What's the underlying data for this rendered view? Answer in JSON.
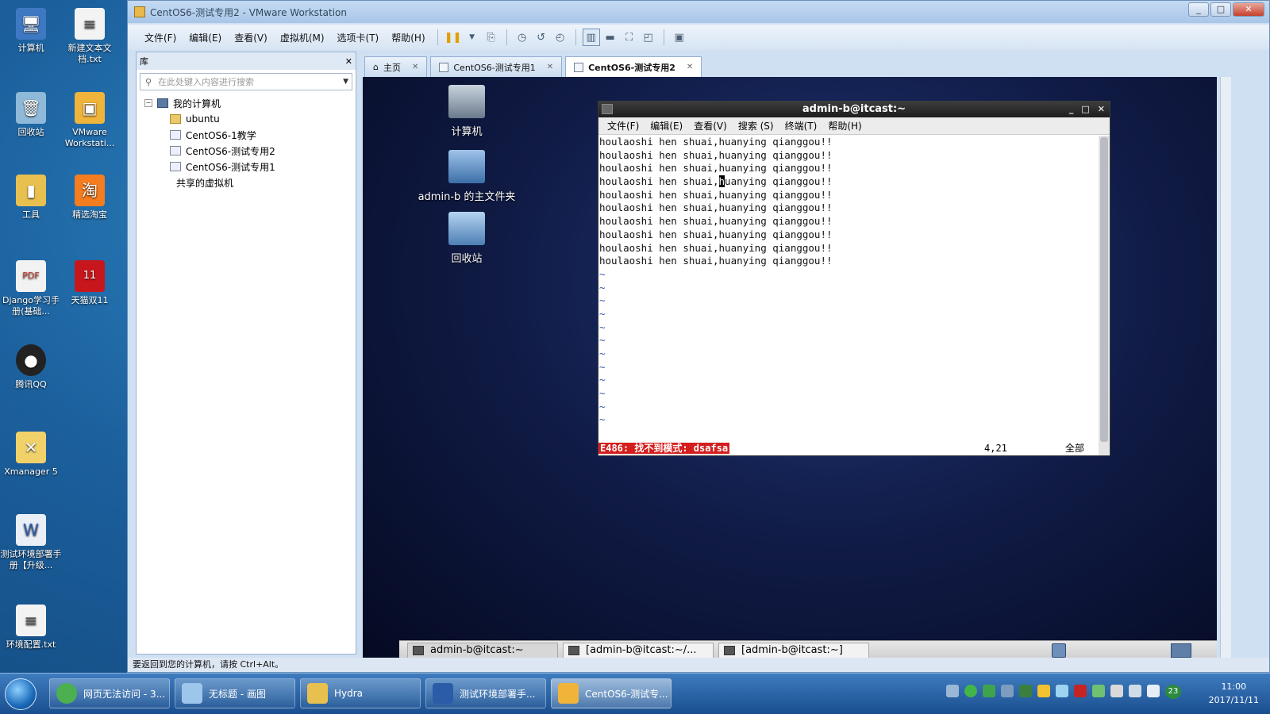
{
  "desktop": {
    "icons": [
      {
        "label": "计算机"
      },
      {
        "label": "新建文本文档.txt"
      },
      {
        "label": "回收站"
      },
      {
        "label": "VMware Workstati..."
      },
      {
        "label": "工具"
      },
      {
        "label": "精选淘宝"
      },
      {
        "label": "Django学习手册(基础..."
      },
      {
        "label": "天猫双11"
      },
      {
        "label": "腾讯QQ"
      },
      {
        "label": "Xmanager 5"
      },
      {
        "label": "测试环境部署手册【升级..."
      },
      {
        "label": "环境配置.txt"
      }
    ]
  },
  "vmware": {
    "title": "CentOS6-测试专用2 - VMware Workstation",
    "menu": [
      "文件(F)",
      "编辑(E)",
      "查看(V)",
      "虚拟机(M)",
      "选项卡(T)",
      "帮助(H)"
    ],
    "library": {
      "title": "库",
      "search_placeholder": "在此处键入内容进行搜索",
      "tree": {
        "root": "我的计算机",
        "items": [
          "ubuntu",
          "CentOS6-1教学",
          "CentOS6-测试专用2",
          "CentOS6-测试专用1"
        ],
        "shared": "共享的虚拟机"
      }
    },
    "tabs": [
      {
        "label": "主页"
      },
      {
        "label": "CentOS6-测试专用1"
      },
      {
        "label": "CentOS6-测试专用2"
      }
    ],
    "statusbar": "要返回到您的计算机，请按 Ctrl+Alt。"
  },
  "guest": {
    "desktop_icons": [
      {
        "label": "计算机"
      },
      {
        "label": "admin-b 的主文件夹"
      },
      {
        "label": "回收站"
      }
    ],
    "terminal": {
      "title": "admin-b@itcast:~",
      "menu": [
        "文件(F)",
        "编辑(E)",
        "查看(V)",
        "搜索 (S)",
        "终端(T)",
        "帮助(H)"
      ],
      "lines": [
        "houlaoshi hen shuai,huanying qianggou!!",
        "houlaoshi hen shuai,huanying qianggou!!",
        "houlaoshi hen shuai,huanying qianggou!!",
        "houlaoshi hen shuai,huanying qianggou!!",
        "houlaoshi hen shuai,huanying qianggou!!",
        "houlaoshi hen shuai,huanying qianggou!!",
        "houlaoshi hen shuai,huanying qianggou!!",
        "houlaoshi hen shuai,huanying qianggou!!",
        "houlaoshi hen shuai,huanying qianggou!!",
        "houlaoshi hen shuai,huanying qianggou!!"
      ],
      "cursor_line": {
        "before": "houlaoshi hen shuai,",
        "cursor": "h",
        "after": "uanying qianggou!!"
      },
      "tilde": "~",
      "status_error": "E486: 找不到模式: dsafsa",
      "status_pos": "4,21",
      "status_all": "全部"
    },
    "taskbar": [
      "admin-b@itcast:~",
      "[admin-b@itcast:~/...",
      "[admin-b@itcast:~]"
    ]
  },
  "taskbar": {
    "tasks": [
      "网页无法访问 - 3...",
      "无标题 - 画图",
      "Hydra",
      "测试环境部署手...",
      "CentOS6-测试专..."
    ],
    "clock_time": "11:00",
    "clock_date": "2017/11/11",
    "tray_badge": "23"
  },
  "colors": {
    "error_bg": "#d41e1e",
    "desktop_bg": "#1b5f9c",
    "guest_bg": "#101b45"
  }
}
